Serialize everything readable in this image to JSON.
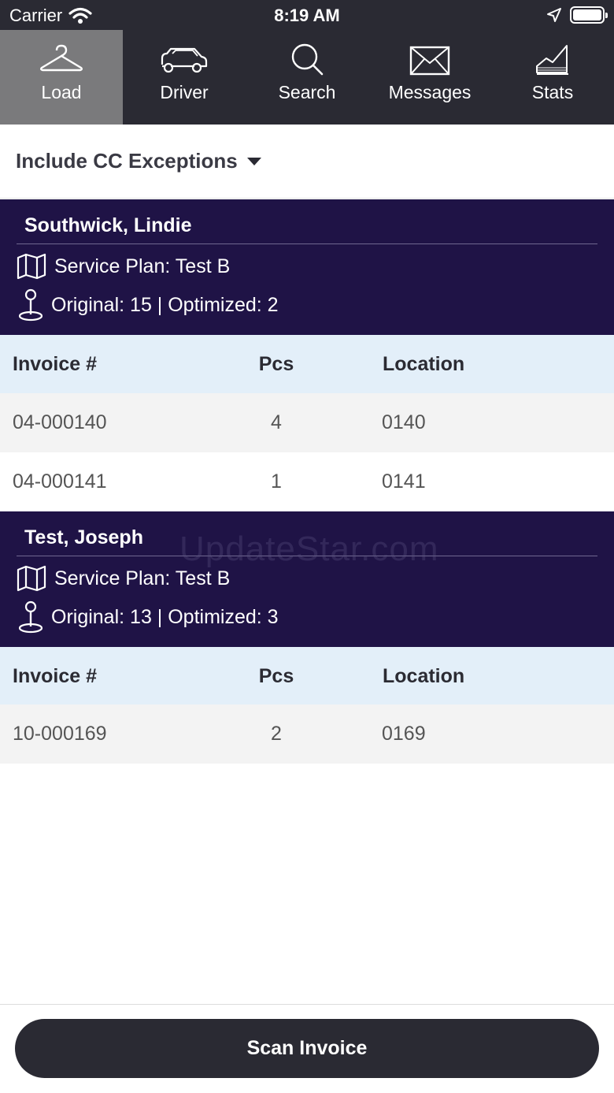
{
  "status_bar": {
    "carrier": "Carrier",
    "time": "8:19 AM"
  },
  "tabs": [
    {
      "label": "Load",
      "icon": "hanger-icon",
      "active": true
    },
    {
      "label": "Driver",
      "icon": "car-icon",
      "active": false
    },
    {
      "label": "Search",
      "icon": "search-icon",
      "active": false
    },
    {
      "label": "Messages",
      "icon": "envelope-icon",
      "active": false
    },
    {
      "label": "Stats",
      "icon": "chart-icon",
      "active": false
    }
  ],
  "filter": {
    "label": "Include CC Exceptions"
  },
  "table_headers": {
    "invoice": "Invoice #",
    "pcs": "Pcs",
    "location": "Location"
  },
  "customers": [
    {
      "name": "Southwick, Lindie",
      "service_plan": "Service Plan: Test B",
      "counts": "Original: 15 | Optimized: 2",
      "rows": [
        {
          "invoice": "04-000140",
          "pcs": "4",
          "location": "0140"
        },
        {
          "invoice": "04-000141",
          "pcs": "1",
          "location": "0141"
        }
      ]
    },
    {
      "name": "Test, Joseph",
      "service_plan": "Service Plan: Test B",
      "counts": "Original: 13 | Optimized: 3",
      "rows": [
        {
          "invoice": "10-000169",
          "pcs": "2",
          "location": "0169"
        }
      ]
    }
  ],
  "watermark": "UpdateStar.com",
  "scan_button": {
    "label": "Scan Invoice"
  },
  "colors": {
    "nav_bg": "#2a2a33",
    "active_tab": "#7a7a7c",
    "customer_bg": "#1f1346",
    "table_head_bg": "#e3eff9"
  }
}
